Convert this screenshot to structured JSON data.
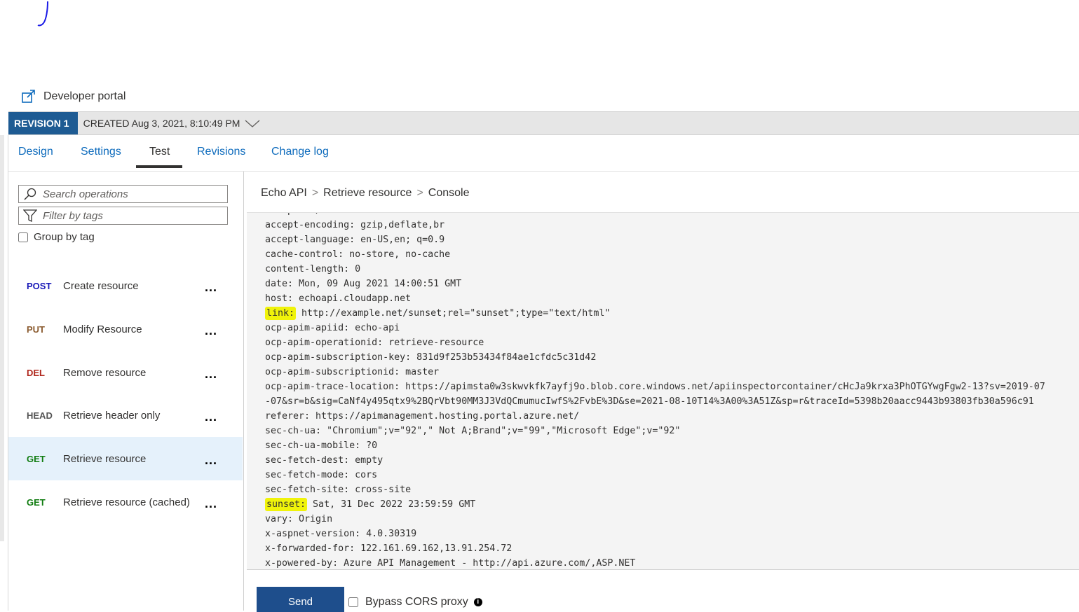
{
  "header": {
    "developer_portal": "Developer portal"
  },
  "revision": {
    "badge": "REVISION 1",
    "created": "CREATED Aug 3, 2021, 8:10:49 PM"
  },
  "tabs": [
    {
      "label": "Design"
    },
    {
      "label": "Settings"
    },
    {
      "label": "Test",
      "active": true
    },
    {
      "label": "Revisions"
    },
    {
      "label": "Change log"
    }
  ],
  "sidebar": {
    "search_placeholder": "Search operations",
    "filter_placeholder": "Filter by tags",
    "group_by_label": "Group by tag",
    "operations": [
      {
        "method": "POST",
        "name": "Create resource",
        "color": "#1a1ab8"
      },
      {
        "method": "PUT",
        "name": "Modify Resource",
        "color": "#8a5a2e"
      },
      {
        "method": "DEL",
        "name": "Remove resource",
        "color": "#b0281e"
      },
      {
        "method": "HEAD",
        "name": "Retrieve header only",
        "color": "#555555"
      },
      {
        "method": "GET",
        "name": "Retrieve resource",
        "color": "#107c10",
        "selected": true
      },
      {
        "method": "GET",
        "name": "Retrieve resource (cached)",
        "color": "#107c10"
      }
    ],
    "more_label": "..."
  },
  "breadcrumb": {
    "api": "Echo API",
    "operation": "Retrieve resource",
    "page": "Console",
    "separator": ">"
  },
  "console": {
    "partial_top": "accept: */*",
    "lines": [
      {
        "key": "accept-encoding:",
        "value": " gzip,deflate,br"
      },
      {
        "key": "accept-language:",
        "value": " en-US,en; q=0.9"
      },
      {
        "key": "cache-control:",
        "value": " no-store, no-cache"
      },
      {
        "key": "content-length:",
        "value": " 0"
      },
      {
        "key": "date:",
        "value": " Mon, 09 Aug 2021 14:00:51 GMT"
      },
      {
        "key": "host:",
        "value": " echoapi.cloudapp.net"
      },
      {
        "key": "link:",
        "value": " http://example.net/sunset;rel=\"sunset\";type=\"text/html\"",
        "highlight": true
      },
      {
        "key": "ocp-apim-apiid:",
        "value": " echo-api"
      },
      {
        "key": "ocp-apim-operationid:",
        "value": " retrieve-resource"
      },
      {
        "key": "ocp-apim-subscription-key:",
        "value": " 831d9f253b53434f84ae1cfdc5c31d42"
      },
      {
        "key": "ocp-apim-subscriptionid:",
        "value": " master"
      },
      {
        "key": "ocp-apim-trace-location:",
        "value": " https://apimsta0w3skwvkfk7ayfj9o.blob.core.windows.net/apiinspectorcontainer/cHcJa9krxa3PhOTGYwgFgw2-13?sv=2019-07"
      },
      {
        "key": "",
        "value": "-07&sr=b&sig=CaNf4y495qtx9%2BQrVbt90MM3J3VdQCmumucIwfS%2FvbE%3D&se=2021-08-10T14%3A00%3A51Z&sp=r&traceId=5398b20aacc9443b93803fb30a596c91"
      },
      {
        "key": "referer:",
        "value": " https://apimanagement.hosting.portal.azure.net/"
      },
      {
        "key": "sec-ch-ua:",
        "value": " \"Chromium\";v=\"92\",\" Not A;Brand\";v=\"99\",\"Microsoft Edge\";v=\"92\""
      },
      {
        "key": "sec-ch-ua-mobile:",
        "value": " ?0"
      },
      {
        "key": "sec-fetch-dest:",
        "value": " empty"
      },
      {
        "key": "sec-fetch-mode:",
        "value": " cors"
      },
      {
        "key": "sec-fetch-site:",
        "value": " cross-site"
      },
      {
        "key": "sunset:",
        "value": " Sat, 31 Dec 2022 23:59:59 GMT",
        "highlight": true
      },
      {
        "key": "vary:",
        "value": " Origin"
      },
      {
        "key": "x-aspnet-version:",
        "value": " 4.0.30319"
      },
      {
        "key": "x-forwarded-for:",
        "value": " 122.161.69.162,13.91.254.72"
      },
      {
        "key": "x-powered-by:",
        "value": " Azure API Management - http://api.azure.com/,ASP.NET"
      }
    ]
  },
  "footer": {
    "send_label": "Send",
    "bypass_label": "Bypass CORS proxy",
    "info_glyph": "i"
  },
  "colors": {
    "accent": "#0f6cbd",
    "revision_badge": "#1e5b93",
    "send_button": "#1e4e8c",
    "highlight": "#f0f30a",
    "selected_row": "#e5f1fb"
  }
}
